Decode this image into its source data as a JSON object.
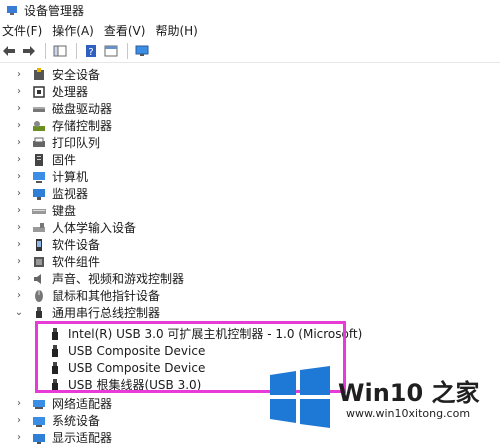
{
  "window": {
    "title": "设备管理器"
  },
  "menu": [
    "文件(F)",
    "操作(A)",
    "查看(V)",
    "帮助(H)"
  ],
  "tree": {
    "categories_top": [
      {
        "label": "安全设备",
        "icon": "security-chip-icon"
      },
      {
        "label": "处理器",
        "icon": "processor-icon"
      },
      {
        "label": "磁盘驱动器",
        "icon": "disk-drive-icon"
      },
      {
        "label": "存储控制器",
        "icon": "storage-controller-icon"
      },
      {
        "label": "打印队列",
        "icon": "printer-icon"
      },
      {
        "label": "固件",
        "icon": "firmware-icon"
      },
      {
        "label": "计算机",
        "icon": "computer-icon"
      },
      {
        "label": "监视器",
        "icon": "monitor-icon"
      },
      {
        "label": "键盘",
        "icon": "keyboard-icon"
      },
      {
        "label": "人体学输入设备",
        "icon": "hid-icon"
      },
      {
        "label": "软件设备",
        "icon": "software-device-icon"
      },
      {
        "label": "软件组件",
        "icon": "software-component-icon"
      },
      {
        "label": "声音、视频和游戏控制器",
        "icon": "speaker-icon"
      },
      {
        "label": "鼠标和其他指针设备",
        "icon": "mouse-icon"
      },
      {
        "label": "通用串行总线控制器",
        "icon": "usb-icon"
      }
    ],
    "usb_children": [
      {
        "label": "Intel(R) USB 3.0 可扩展主机控制器 - 1.0 (Microsoft)"
      },
      {
        "label": "USB Composite Device"
      },
      {
        "label": "USB Composite Device"
      },
      {
        "label": "USB 根集线器(USB 3.0)"
      }
    ],
    "categories_bottom": [
      {
        "label": "网络适配器",
        "icon": "network-adapter-icon"
      },
      {
        "label": "系统设备",
        "icon": "system-device-icon"
      },
      {
        "label": "显示适配器",
        "icon": "display-adapter-icon"
      }
    ]
  },
  "watermark": {
    "brand": "Win10 之家",
    "url": "www.win10xitong.com"
  },
  "colors": {
    "highlight": "#e83ad6",
    "win_blue": "#1e78d6"
  }
}
